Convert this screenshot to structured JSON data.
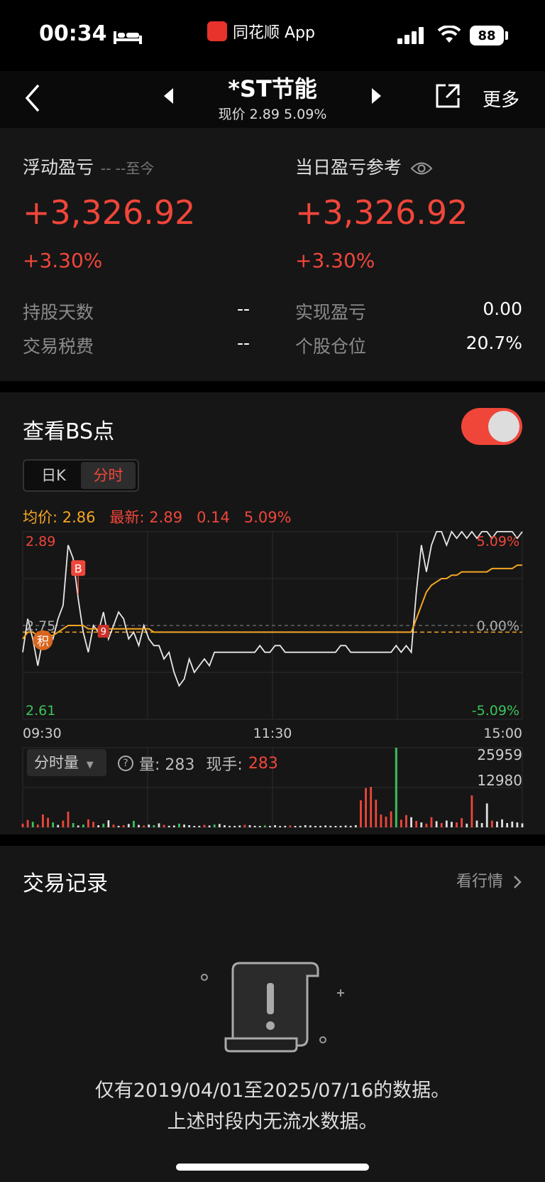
{
  "status": {
    "time": "00:34",
    "app_name": "同花顺 App",
    "battery": "88"
  },
  "nav": {
    "title": "*ST节能",
    "subtitle": "现价 2.89 5.09%",
    "more_label": "更多"
  },
  "pnl": {
    "floating_label": "浮动盈亏",
    "floating_range": "-- --至今",
    "floating_value": "+3,326.92",
    "floating_pct": "+3.30%",
    "daily_label": "当日盈亏参考",
    "daily_value": "+3,326.92",
    "daily_pct": "+3.30%",
    "stats": [
      {
        "label": "持股天数",
        "value": "--"
      },
      {
        "label": "实现盈亏",
        "value": "0.00"
      },
      {
        "label": "交易税费",
        "value": "--"
      },
      {
        "label": "个股仓位",
        "value": "20.7%"
      }
    ]
  },
  "bs": {
    "title": "查看BS点",
    "toggle_on": true,
    "tabs": [
      "日K",
      "分时"
    ],
    "active_tab": "分时",
    "avg_label": "均价: 2.86",
    "latest_label": "最新: 2.89",
    "change": "0.14",
    "change_pct": "5.09%"
  },
  "chart_data": {
    "type": "line",
    "x_labels": [
      "09:30",
      "11:30",
      "15:00"
    ],
    "ylim": [
      2.61,
      2.89
    ],
    "y_ticks_left": [
      "2.89",
      "2.75",
      "2.61"
    ],
    "y_ticks_right": [
      "5.09%",
      "0.00%",
      "-5.09%"
    ],
    "prev_close": 2.75,
    "series": [
      {
        "name": "最新",
        "color": "#e8e8e8",
        "values": [
          2.71,
          2.76,
          2.73,
          2.69,
          2.73,
          2.74,
          2.73,
          2.76,
          2.78,
          2.87,
          2.85,
          2.79,
          2.74,
          2.71,
          2.75,
          2.74,
          2.77,
          2.73,
          2.75,
          2.77,
          2.76,
          2.73,
          2.74,
          2.72,
          2.75,
          2.73,
          2.72,
          2.72,
          2.7,
          2.71,
          2.68,
          2.66,
          2.67,
          2.7,
          2.68,
          2.69,
          2.7,
          2.69,
          2.71,
          2.71,
          2.71,
          2.71,
          2.71,
          2.71,
          2.71,
          2.71,
          2.71,
          2.72,
          2.71,
          2.71,
          2.72,
          2.72,
          2.71,
          2.71,
          2.71,
          2.71,
          2.71,
          2.71,
          2.71,
          2.71,
          2.71,
          2.71,
          2.71,
          2.72,
          2.72,
          2.71,
          2.71,
          2.71,
          2.71,
          2.71,
          2.71,
          2.71,
          2.71,
          2.71,
          2.72,
          2.71,
          2.72,
          2.71,
          2.8,
          2.87,
          2.83,
          2.87,
          2.89,
          2.89,
          2.87,
          2.89,
          2.88,
          2.89,
          2.88,
          2.89,
          2.88,
          2.89,
          2.89,
          2.88,
          2.89,
          2.89,
          2.89,
          2.89,
          2.88,
          2.89
        ]
      },
      {
        "name": "均价",
        "color": "#f5a623",
        "values": [
          2.73,
          2.74,
          2.74,
          2.735,
          2.735,
          2.735,
          2.735,
          2.74,
          2.745,
          2.75,
          2.75,
          2.75,
          2.75,
          2.745,
          2.745,
          2.745,
          2.745,
          2.745,
          2.745,
          2.745,
          2.745,
          2.745,
          2.745,
          2.745,
          2.745,
          2.745,
          2.74,
          2.74,
          2.74,
          2.74,
          2.74,
          2.74,
          2.74,
          2.74,
          2.74,
          2.74,
          2.74,
          2.74,
          2.74,
          2.74,
          2.74,
          2.74,
          2.74,
          2.74,
          2.74,
          2.74,
          2.74,
          2.74,
          2.74,
          2.74,
          2.74,
          2.74,
          2.74,
          2.74,
          2.74,
          2.74,
          2.74,
          2.74,
          2.74,
          2.74,
          2.74,
          2.74,
          2.74,
          2.74,
          2.74,
          2.74,
          2.74,
          2.74,
          2.74,
          2.74,
          2.74,
          2.74,
          2.74,
          2.74,
          2.74,
          2.74,
          2.74,
          2.74,
          2.76,
          2.78,
          2.8,
          2.81,
          2.815,
          2.82,
          2.82,
          2.825,
          2.825,
          2.83,
          2.83,
          2.83,
          2.83,
          2.83,
          2.83,
          2.835,
          2.835,
          2.835,
          2.835,
          2.835,
          2.84,
          2.84
        ]
      }
    ],
    "markers": [
      {
        "label": "B",
        "type": "buy",
        "index": 11
      },
      {
        "label": "9",
        "type": "sell",
        "index": 16
      },
      {
        "label": "积",
        "type": "hold",
        "index": 4
      }
    ],
    "cost_line": 2.74,
    "volume": {
      "select_label": "分时量",
      "amount_label": "量: 283",
      "hand_label": "现手:",
      "hand_value": "283",
      "ticks": [
        "25959",
        "12980"
      ],
      "max": 25959,
      "values": [
        1200,
        2400,
        1800,
        900,
        4200,
        3100,
        1600,
        800,
        2200,
        5100,
        1400,
        600,
        900,
        2600,
        1800,
        700,
        1200,
        2300,
        900,
        500,
        700,
        1100,
        2100,
        800,
        600,
        900,
        700,
        1300,
        800,
        500,
        600,
        1200,
        900,
        700,
        400,
        500,
        800,
        600,
        900,
        1100,
        700,
        500,
        400,
        600,
        800,
        700,
        500,
        400,
        600,
        500,
        700,
        400,
        500,
        600,
        400,
        500,
        700,
        600,
        400,
        500,
        600,
        500,
        400,
        500,
        600,
        500,
        700,
        8800,
        12800,
        13200,
        9000,
        4200,
        3500,
        5200,
        25959,
        2500,
        4000,
        3300,
        2100,
        1600,
        1200,
        3300,
        2000,
        1400,
        2200,
        1800,
        1600,
        3000,
        1200,
        10400,
        2200,
        1400,
        7800,
        2200,
        1900,
        2600,
        1400,
        1900,
        1600,
        1300
      ],
      "colors": [
        "r",
        "r",
        "g",
        "r",
        "r",
        "r",
        "g",
        "w",
        "r",
        "r",
        "g",
        "w",
        "g",
        "r",
        "r",
        "w",
        "g",
        "w",
        "r",
        "w",
        "r",
        "w",
        "g",
        "w",
        "r",
        "w",
        "g",
        "w",
        "r",
        "w",
        "w",
        "g",
        "w",
        "w",
        "w",
        "w",
        "r",
        "w",
        "g",
        "w",
        "w",
        "w",
        "w",
        "w",
        "r",
        "w",
        "w",
        "w",
        "g",
        "w",
        "w",
        "w",
        "w",
        "r",
        "w",
        "w",
        "w",
        "w",
        "w",
        "w",
        "w",
        "w",
        "w",
        "w",
        "w",
        "w",
        "w",
        "r",
        "r",
        "r",
        "r",
        "r",
        "r",
        "r",
        "g",
        "r",
        "r",
        "w",
        "r",
        "w",
        "r",
        "r",
        "w",
        "r",
        "w",
        "w",
        "r",
        "r",
        "w",
        "r",
        "w",
        "w",
        "w",
        "r",
        "w",
        "w",
        "w",
        "w",
        "w",
        "w"
      ]
    }
  },
  "records": {
    "title": "交易记录",
    "link_label": "看行情",
    "empty_line1": "仅有2019/04/01至2025/07/16的数据。",
    "empty_line2": "上述时段内无流水数据。"
  }
}
